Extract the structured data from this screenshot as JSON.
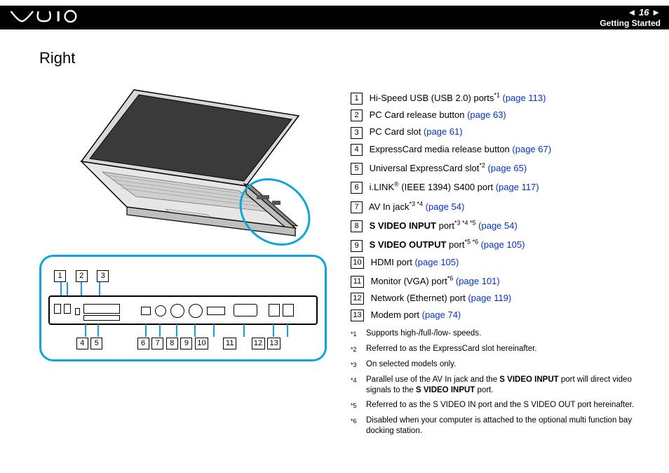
{
  "header": {
    "page_number": "16",
    "section": "Getting Started"
  },
  "page_title": "Right",
  "items": [
    {
      "n": "1",
      "pre": "",
      "text": "Hi-Speed USB (USB 2.0) ports",
      "sup": "*1",
      "link": "(page 113)"
    },
    {
      "n": "2",
      "pre": "",
      "text": "PC Card release button ",
      "sup": "",
      "link": "(page 63)"
    },
    {
      "n": "3",
      "pre": "",
      "text": "PC Card slot ",
      "sup": "",
      "link": "(page 61)"
    },
    {
      "n": "4",
      "pre": "",
      "text": "ExpressCard media release button ",
      "sup": "",
      "link": "(page 67)"
    },
    {
      "n": "5",
      "pre": "",
      "text": "Universal ExpressCard slot",
      "sup": "*2",
      "link": "(page 65)"
    },
    {
      "n": "6",
      "pre": "",
      "text": "i.LINK® (IEEE 1394) S400 port ",
      "sup": "",
      "link": "(page 117)"
    },
    {
      "n": "7",
      "pre": "",
      "text": "AV In jack",
      "sup": "*3 *4",
      "link": "(page 54)"
    },
    {
      "n": "8",
      "pre": "S VIDEO INPUT",
      "text": " port",
      "sup": "*3 *4 *5",
      "link": "(page 54)"
    },
    {
      "n": "9",
      "pre": "S VIDEO OUTPUT",
      "text": " port",
      "sup": "*5 *6",
      "link": "(page 105)"
    },
    {
      "n": "10",
      "pre": "",
      "text": "HDMI port ",
      "sup": "",
      "link": "(page 105)"
    },
    {
      "n": "11",
      "pre": "",
      "text": "Monitor (VGA) port",
      "sup": "*6",
      "link": "(page 101)"
    },
    {
      "n": "12",
      "pre": "",
      "text": "Network (Ethernet) port ",
      "sup": "",
      "link": "(page 119)"
    },
    {
      "n": "13",
      "pre": "",
      "text": "Modem port ",
      "sup": "",
      "link": "(page 74)"
    }
  ],
  "footnotes": [
    {
      "n": "*1",
      "text": "Supports high-/full-/low- speeds."
    },
    {
      "n": "*2",
      "text": "Referred to as the ExpressCard slot hereinafter."
    },
    {
      "n": "*3",
      "text": "On selected models only."
    },
    {
      "n": "*4",
      "text": "Parallel use of the AV In jack and the S VIDEO INPUT port will direct video signals to the S VIDEO INPUT port."
    },
    {
      "n": "*5",
      "text": "Referred to as the S VIDEO IN port and the S VIDEO OUT port hereinafter."
    },
    {
      "n": "*6",
      "text": "Disabled when your computer is attached to the optional multi function bay docking station."
    }
  ],
  "diagram": {
    "top_labels": [
      "1",
      "2",
      "3"
    ],
    "bottom_labels": [
      "4",
      "5",
      "6",
      "7",
      "8",
      "9",
      "10",
      "11",
      "12",
      "13"
    ]
  }
}
